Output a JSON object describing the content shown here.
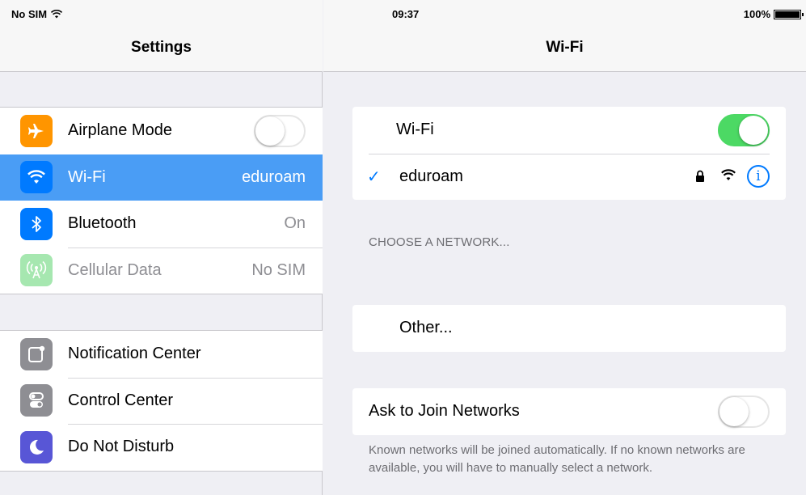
{
  "status": {
    "carrier": "No SIM",
    "time": "09:37",
    "battery": "100%"
  },
  "left": {
    "title": "Settings",
    "group1": [
      {
        "label": "Airplane Mode",
        "value": "",
        "icon": "airplane-icon",
        "color": "#ff9500",
        "toggle": "off"
      },
      {
        "label": "Wi-Fi",
        "value": "eduroam",
        "icon": "wifi-icon",
        "color": "#007aff",
        "selected": true
      },
      {
        "label": "Bluetooth",
        "value": "On",
        "icon": "bluetooth-icon",
        "color": "#007aff"
      },
      {
        "label": "Cellular Data",
        "value": "No SIM",
        "icon": "cellular-icon",
        "color": "#a6e7b0",
        "disabled": true
      }
    ],
    "group2": [
      {
        "label": "Notification Center",
        "icon": "notification-center-icon",
        "color": "#8e8e93"
      },
      {
        "label": "Control Center",
        "icon": "control-center-icon",
        "color": "#8e8e93"
      },
      {
        "label": "Do Not Disturb",
        "icon": "moon-icon",
        "color": "#5856d6"
      }
    ]
  },
  "right": {
    "title": "Wi-Fi",
    "wifi_label": "Wi-Fi",
    "wifi_toggle": "on",
    "connected_network": "eduroam",
    "choose_header": "CHOOSE A NETWORK...",
    "other_label": "Other...",
    "ask_label": "Ask to Join Networks",
    "ask_toggle": "off",
    "footnote": "Known networks will be joined automatically. If no known networks are available, you will have to manually select a network."
  },
  "colors": {
    "accent": "#007aff",
    "selected_row": "#4a9df5",
    "toggle_on": "#4cd964"
  }
}
